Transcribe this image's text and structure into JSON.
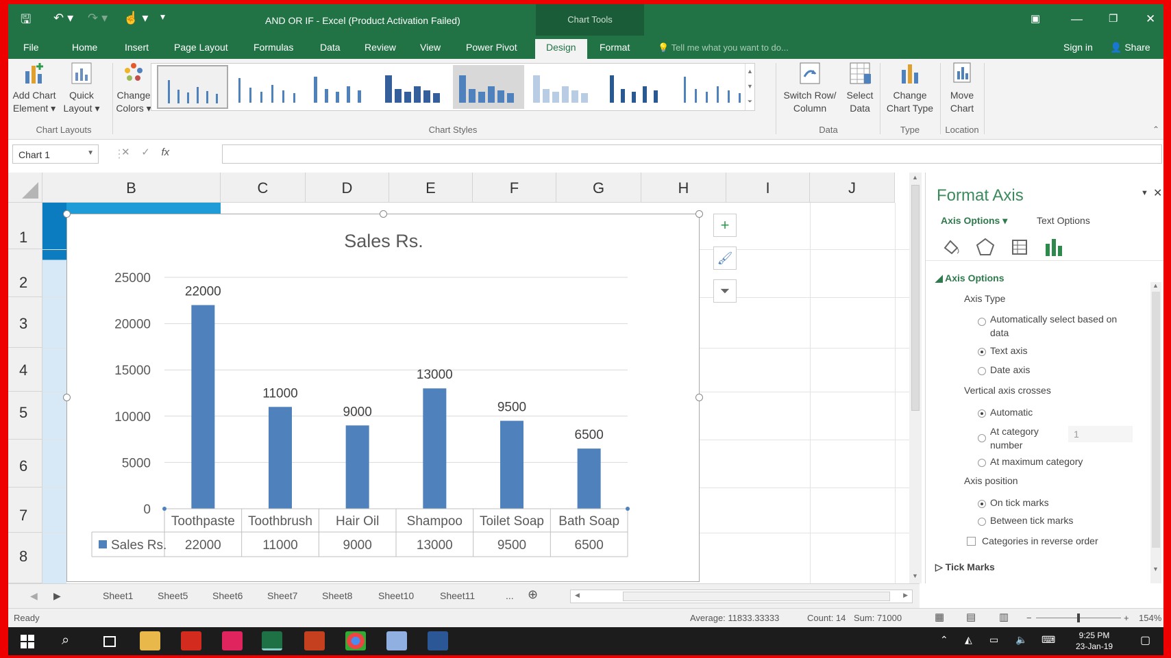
{
  "window": {
    "title": "AND OR IF - Excel (Product Activation Failed)",
    "context_tab": "Chart Tools",
    "accent": "#217346"
  },
  "tabs": [
    "File",
    "Home",
    "Insert",
    "Page Layout",
    "Formulas",
    "Data",
    "Review",
    "View",
    "Power Pivot",
    "Design",
    "Format"
  ],
  "active_tab": "Design",
  "tell_me_placeholder": "Tell me what you want to do...",
  "sign_in": "Sign in",
  "share": "Share",
  "ribbon": {
    "add_chart_element": [
      "Add Chart",
      "Element ▾"
    ],
    "quick_layout": [
      "Quick",
      "Layout ▾"
    ],
    "change_colors": [
      "Change",
      "Colors ▾"
    ],
    "switch_row_col": [
      "Switch Row/",
      "Column"
    ],
    "select_data": [
      "Select",
      "Data"
    ],
    "change_chart_type": [
      "Change",
      "Chart Type"
    ],
    "move_chart": [
      "Move",
      "Chart"
    ],
    "groups": {
      "chart_layouts": "Chart Layouts",
      "chart_styles": "Chart Styles",
      "data": "Data",
      "type": "Type",
      "location": "Location"
    }
  },
  "name_box": "Chart 1",
  "columns": [
    "B",
    "C",
    "D",
    "E",
    "F",
    "G",
    "H",
    "I",
    "J"
  ],
  "rows": [
    "1",
    "2",
    "3",
    "4",
    "5",
    "6",
    "7",
    "8"
  ],
  "chart_data": {
    "type": "bar",
    "title": "Sales Rs.",
    "categories": [
      "Toothpaste",
      "Toothbrush",
      "Hair Oil",
      "Shampoo",
      "Toilet Soap",
      "Bath Soap"
    ],
    "series": [
      {
        "name": "Sales Rs.",
        "values": [
          22000,
          11000,
          9000,
          13000,
          9500,
          6500
        ],
        "color": "#4f81bd"
      }
    ],
    "yticks": [
      "0",
      "5000",
      "10000",
      "15000",
      "20000",
      "25000"
    ],
    "ylim": [
      0,
      25000
    ],
    "data_table": true,
    "grid": true
  },
  "format_pane": {
    "title": "Format Axis",
    "tab_axis_options": "Axis Options",
    "tab_text_options": "Text Options",
    "section": "Axis Options",
    "axis_type_label": "Axis Type",
    "axis_type_options": [
      "Automatically select based on",
      "data",
      "Text axis",
      "Date axis"
    ],
    "vertical_crosses_label": "Vertical axis crosses",
    "crosses_options": [
      "Automatic",
      "At category",
      "number",
      "At maximum category"
    ],
    "category_number": "1",
    "axis_position_label": "Axis position",
    "position_options": [
      "On tick marks",
      "Between tick marks"
    ],
    "reverse_order": "Categories in reverse order",
    "tick_marks": "Tick Marks"
  },
  "sheet_tabs": [
    "Sheet1",
    "Sheet5",
    "Sheet6",
    "Sheet7",
    "Sheet8",
    "Sheet10",
    "Sheet11",
    "..."
  ],
  "status": {
    "ready": "Ready",
    "average": "Average: 11833.33333",
    "count": "Count: 14",
    "sum": "Sum: 71000",
    "zoom": "154%"
  },
  "clock": {
    "time": "9:25 PM",
    "date": "23-Jan-19"
  }
}
